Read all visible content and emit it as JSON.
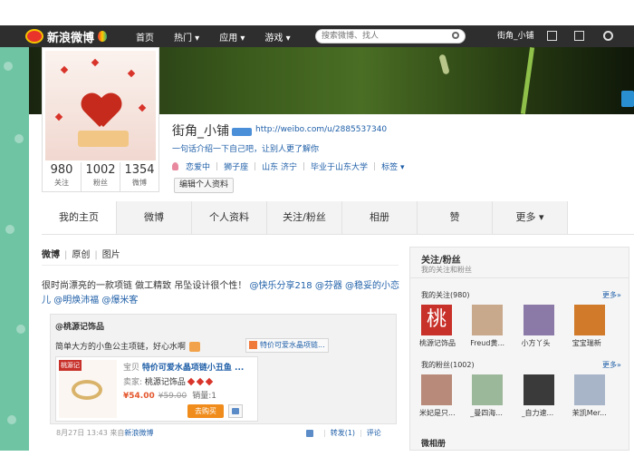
{
  "topnav": {
    "logo_text": "新浪微博",
    "items": [
      "首页",
      "热门",
      "应用",
      "游戏"
    ],
    "dropdown_flags": [
      false,
      true,
      true,
      true
    ],
    "search_placeholder": "搜索微博、找人",
    "username": "街角_小铺"
  },
  "profile": {
    "name": "街角_小铺",
    "url": "http://weibo.com/u/2885537340",
    "bio": "一句话介绍一下自己吧，让别人更了解你",
    "tags": [
      "恋爱中",
      "狮子座",
      "山东 济宁",
      "毕业于山东大学",
      "标签"
    ],
    "edit_button": "编辑个人资料",
    "stats": [
      {
        "num": "980",
        "label": "关注"
      },
      {
        "num": "1002",
        "label": "粉丝"
      },
      {
        "num": "1354",
        "label": "微博"
      }
    ]
  },
  "tabs": [
    "我的主页",
    "微博",
    "个人资料",
    "关注/粉丝",
    "相册",
    "赞",
    "更多"
  ],
  "subtabs": [
    "微博",
    "原创",
    "图片"
  ],
  "post": {
    "text": "很时尚漂亮的一款项链 做工精致 吊坠设计很个性！",
    "mentions": [
      "@快乐分享218",
      "@芬器",
      "@稳妥的小恋儿",
      "@明焕沛福",
      "@爆米客"
    ],
    "repost": {
      "author": "@桃源记饰品",
      "text": "简单大方的小鱼公主项链，好心水啊",
      "link_label": "特价可爱水晶项链...",
      "product": {
        "brand": "桃源记",
        "title_key": "宝贝",
        "title": "特价可爱水晶项链小丑鱼 ...",
        "seller_key": "卖家:",
        "seller": "桃源记饰品",
        "price_now": "¥54.00",
        "price_old": "¥59.00",
        "sold": "销量:1",
        "buy_label": "去购买"
      }
    },
    "meta_time": "8月27日 13:43",
    "meta_from": "来自",
    "meta_source": "新浪微博",
    "actions": [
      "转发(1)",
      "评论"
    ]
  },
  "sidebar": {
    "title": "关注/粉丝",
    "subtitle": "我的关注和粉丝",
    "following_label": "我的关注(980)",
    "followers_label": "我的粉丝(1002)",
    "more_label": "更多»",
    "following": [
      {
        "name": "桃源记饰品",
        "color": "#c8302a"
      },
      {
        "name": "Freud黄...",
        "color": "#c9a98c"
      },
      {
        "name": "小方丫头",
        "color": "#8b7aa8"
      },
      {
        "name": "宝宝瑞新",
        "color": "#d07a2a"
      }
    ],
    "followers": [
      {
        "name": "米妃是只...",
        "color": "#b88a7a"
      },
      {
        "name": "_曼四海...",
        "color": "#9cb89a"
      },
      {
        "name": "_自力速...",
        "color": "#3a3a3a"
      },
      {
        "name": "茉凯Mer...",
        "color": "#a8b4c8"
      }
    ],
    "footer": "微相册"
  }
}
